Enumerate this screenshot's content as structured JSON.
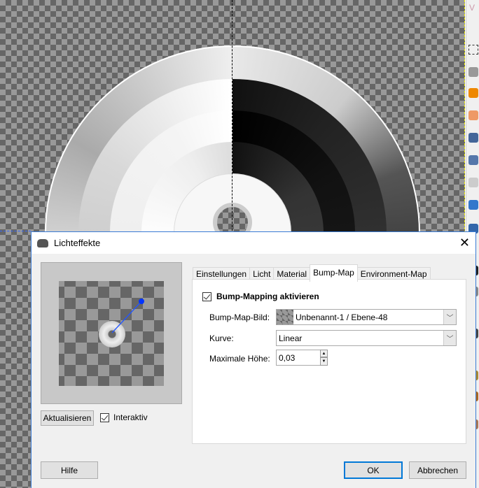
{
  "dialog": {
    "title": "Lichteffekte",
    "close_icon": "close-icon",
    "app_icon": "gimp-wilber-icon"
  },
  "preview": {
    "update_button": "Aktualisieren",
    "interactive_label": "Interaktiv",
    "interactive_checked": true,
    "light_color": "#0033ff"
  },
  "tabs": [
    {
      "label": "Einstellungen"
    },
    {
      "label": "Licht"
    },
    {
      "label": "Material"
    },
    {
      "label": "Bump-Map",
      "active": true
    },
    {
      "label": "Environment-Map"
    }
  ],
  "bumpmap": {
    "enable_label": "Bump-Mapping aktivieren",
    "enable_checked": true,
    "image_label": "Bump-Map-Bild:",
    "image_value": "Unbenannt-1 / Ebene-48",
    "curve_label": "Kurve:",
    "curve_value": "Linear",
    "max_height_label": "Maximale Höhe:",
    "max_height_value": "0,03"
  },
  "buttons": {
    "help": "Hilfe",
    "ok": "OK",
    "cancel": "Abbrechen"
  },
  "toolbox": {
    "header_letter": "V"
  }
}
